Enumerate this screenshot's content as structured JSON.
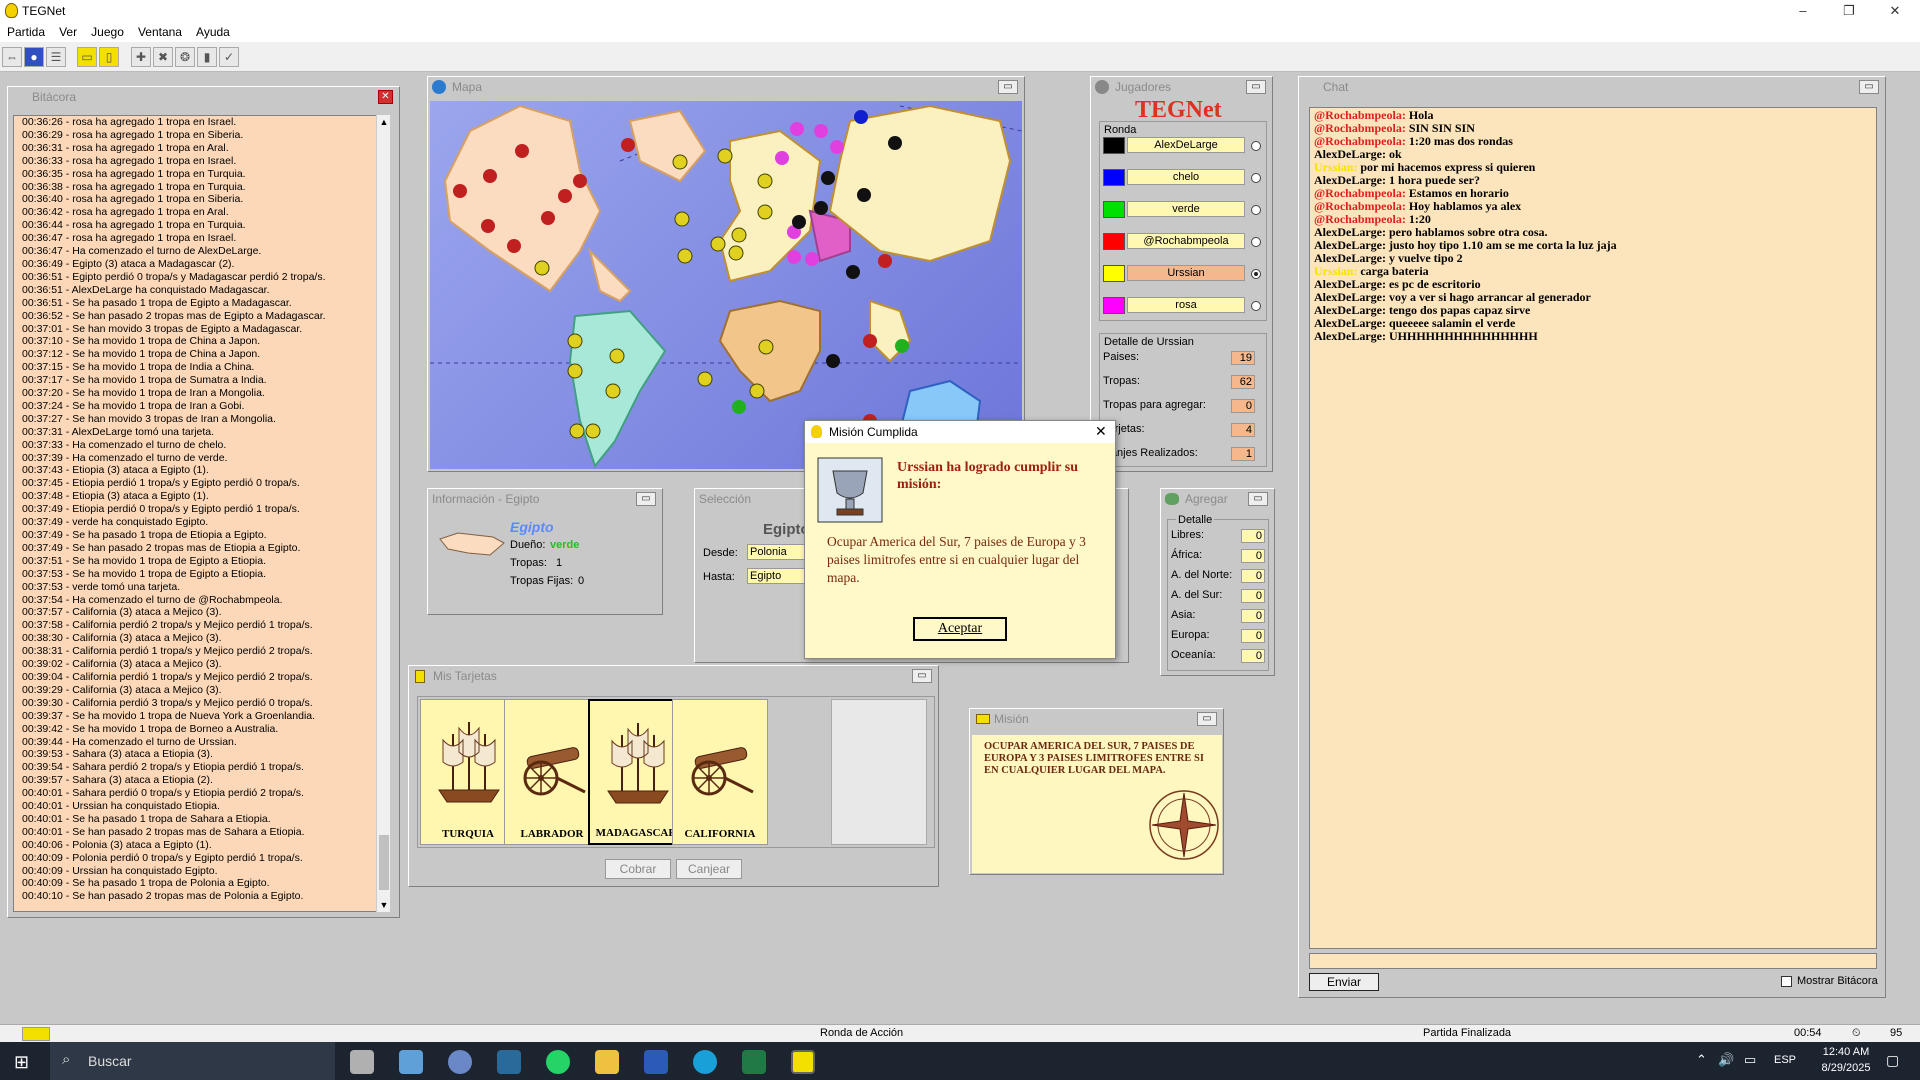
{
  "window": {
    "title": "TEGNet",
    "minimize": "–",
    "restore": "❐",
    "close": "✕"
  },
  "menu": [
    "Partida",
    "Ver",
    "Juego",
    "Ventana",
    "Ayuda"
  ],
  "bitacora": {
    "title": "Bitácora",
    "lines": [
      "00:36:26 - rosa ha agregado 1 tropa en Israel.",
      "00:36:29 - rosa ha agregado 1 tropa en Siberia.",
      "00:36:31 - rosa ha agregado 1 tropa en Aral.",
      "00:36:33 - rosa ha agregado 1 tropa en Israel.",
      "00:36:35 - rosa ha agregado 1 tropa en Turquia.",
      "00:36:38 - rosa ha agregado 1 tropa en Turquia.",
      "00:36:40 - rosa ha agregado 1 tropa en Siberia.",
      "00:36:42 - rosa ha agregado 1 tropa en Aral.",
      "00:36:44 - rosa ha agregado 1 tropa en Turquia.",
      "00:36:47 - rosa ha agregado 1 tropa en Israel.",
      "00:36:47 - Ha comenzado el turno de AlexDeLarge.",
      "00:36:49 - Egipto (3) ataca a Madagascar (2).",
      "00:36:51 - Egipto perdió 0 tropa/s y Madagascar perdió 2 tropa/s.",
      "00:36:51 - AlexDeLarge ha conquistado Madagascar.",
      "00:36:51 - Se ha pasado 1 tropa de Egipto a Madagascar.",
      "00:36:52 - Se han pasado 2 tropas mas de Egipto a Madagascar.",
      "00:37:01 - Se han movido 3 tropas de Egipto a Madagascar.",
      "00:37:10 - Se ha movido 1 tropa de China a Japon.",
      "00:37:12 - Se ha movido 1 tropa de China a Japon.",
      "00:37:15 - Se ha movido 1 tropa de India a China.",
      "00:37:17 - Se ha movido 1 tropa de Sumatra a India.",
      "00:37:20 - Se ha movido 1 tropa de Iran a Mongolia.",
      "00:37:24 - Se ha movido 1 tropa de Iran a Gobi.",
      "00:37:27 - Se han movido 3 tropas de Iran a Mongolia.",
      "00:37:31 - AlexDeLarge tomó una tarjeta.",
      "00:37:33 - Ha comenzado el turno de chelo.",
      "00:37:39 - Ha comenzado el turno de verde.",
      "00:37:43 - Etiopia (3) ataca a Egipto (1).",
      "00:37:45 - Etiopia perdió 1 tropa/s y Egipto perdió 0 tropa/s.",
      "00:37:48 - Etiopia (3) ataca a Egipto (1).",
      "00:37:49 - Etiopia perdió 0 tropa/s y Egipto perdió 1 tropa/s.",
      "00:37:49 - verde ha conquistado Egipto.",
      "00:37:49 - Se ha pasado 1 tropa de Etiopia a Egipto.",
      "00:37:49 - Se han pasado 2 tropas mas de Etiopia a Egipto.",
      "00:37:51 - Se ha movido 1 tropa de Egipto a Etiopia.",
      "00:37:53 - Se ha movido 1 tropa de Egipto a Etiopia.",
      "00:37:53 - verde tomó una tarjeta.",
      "00:37:54 - Ha comenzado el turno de @Rochabmpeola.",
      "00:37:57 - California (3) ataca a Mejico (3).",
      "00:37:58 - California perdió 2 tropa/s y Mejico perdió 1 tropa/s.",
      "00:38:30 - California (3) ataca a Mejico (3).",
      "00:38:31 - California perdió 1 tropa/s y Mejico perdió 2 tropa/s.",
      "00:39:02 - California (3) ataca a Mejico (3).",
      "00:39:04 - California perdió 1 tropa/s y Mejico perdió 2 tropa/s.",
      "00:39:29 - California (3) ataca a Mejico (3).",
      "00:39:30 - California perdió 3 tropa/s y Mejico perdió 0 tropa/s.",
      "00:39:37 - Se ha movido 1 tropa de Nueva York a Groenlandia.",
      "00:39:42 - Se ha movido 1 tropa de Borneo a Australia.",
      "00:39:44 - Ha comenzado el turno de Urssian.",
      "00:39:53 - Sahara (3) ataca a Etiopia (3).",
      "00:39:54 - Sahara perdió 2 tropa/s y Etiopia perdió 1 tropa/s.",
      "00:39:57 - Sahara (3) ataca a Etiopia (2).",
      "00:40:01 - Sahara perdió 0 tropa/s y Etiopia perdió 2 tropa/s.",
      "00:40:01 - Urssian ha conquistado Etiopia.",
      "00:40:01 - Se ha pasado 1 tropa de Sahara a Etiopia.",
      "00:40:01 - Se han pasado 2 tropas mas de Sahara a Etiopia.",
      "00:40:06 - Polonia (3) ataca a Egipto (1).",
      "00:40:09 - Polonia perdió 0 tropa/s y Egipto perdió 1 tropa/s.",
      "00:40:09 - Urssian ha conquistado Egipto.",
      "00:40:09 - Se ha pasado 1 tropa de Polonia a Egipto.",
      "00:40:10 - Se han pasado 2 tropas mas de Polonia a Egipto."
    ]
  },
  "mapa": {
    "title": "Mapa"
  },
  "jugadores": {
    "title": "Jugadores",
    "logo": "TEGNet",
    "ronda_label": "Ronda",
    "players": [
      {
        "name": "AlexDeLarge",
        "color": "#000000",
        "selected": false
      },
      {
        "name": "chelo",
        "color": "#0000ff",
        "selected": false
      },
      {
        "name": "verde",
        "color": "#00e000",
        "selected": false
      },
      {
        "name": "@Rochabmpeola",
        "color": "#ff0000",
        "selected": false
      },
      {
        "name": "Urssian",
        "color": "#ffff00",
        "selected": true
      },
      {
        "name": "rosa",
        "color": "#ff00ff",
        "selected": false
      }
    ],
    "detalle_title": "Detalle de Urssian",
    "stats": [
      {
        "label": "Paises:",
        "value": "19"
      },
      {
        "label": "Tropas:",
        "value": "62"
      },
      {
        "label": "Tropas para agregar:",
        "value": "0"
      },
      {
        "label": "Tarjetas:",
        "value": "4"
      },
      {
        "label": "Canjes Realizados:",
        "value": "1"
      }
    ]
  },
  "chat": {
    "title": "Chat",
    "messages": [
      {
        "user": "@Rochabmpeola:",
        "text": " Hola",
        "cls": "u-r"
      },
      {
        "user": "@Rochabmpeola:",
        "text": " SIN SIN SIN",
        "cls": "u-r"
      },
      {
        "user": "@Rochabmpeola:",
        "text": " 1:20 mas dos rondas",
        "cls": "u-r"
      },
      {
        "user": "AlexDeLarge:",
        "text": " ok",
        "cls": ""
      },
      {
        "user": "Urssian:",
        "text": " por mi hacemos express si quieren",
        "cls": "u-y"
      },
      {
        "user": "AlexDeLarge:",
        "text": " 1 hora puede ser?",
        "cls": ""
      },
      {
        "user": "@Rochabmpeola:",
        "text": " Estamos en horario",
        "cls": "u-r"
      },
      {
        "user": "@Rochabmpeola:",
        "text": " Hoy hablamos ya alex",
        "cls": "u-r"
      },
      {
        "user": "@Rochabmpeola:",
        "text": " 1:20",
        "cls": "u-r"
      },
      {
        "user": "AlexDeLarge:",
        "text": " pero hablamos sobre otra cosa.",
        "cls": ""
      },
      {
        "user": "AlexDeLarge:",
        "text": " justo hoy tipo 1.10 am se me corta la luz jaja",
        "cls": ""
      },
      {
        "user": "AlexDeLarge:",
        "text": " y vuelve tipo 2",
        "cls": ""
      },
      {
        "user": "Urssian:",
        "text": " carga bateria",
        "cls": "u-y"
      },
      {
        "user": "AlexDeLarge:",
        "text": " es pc de escritorio",
        "cls": ""
      },
      {
        "user": "AlexDeLarge:",
        "text": " voy a ver si hago arrancar al generador",
        "cls": ""
      },
      {
        "user": "AlexDeLarge:",
        "text": " tengo dos papas capaz sirve",
        "cls": ""
      },
      {
        "user": "AlexDeLarge:",
        "text": " queeeee salamin el verde",
        "cls": ""
      },
      {
        "user": "AlexDeLarge:",
        "text": " UHHHHHHHHHHHHHHH",
        "cls": ""
      }
    ],
    "send_label": "Enviar",
    "show_bitacora_label": "Mostrar Bitácora"
  },
  "info": {
    "title": "Información - Egipto",
    "country": "Egipto",
    "owner_label": "Dueño:",
    "owner": "verde",
    "troops_label": "Tropas:",
    "troops": "1",
    "fixed_label": "Tropas Fijas:",
    "fixed": "0"
  },
  "seleccion": {
    "title": "Selección",
    "country": "Egipto",
    "desde_label": "Desde:",
    "desde": "Polonia",
    "hasta_label": "Hasta:",
    "hasta": "Egipto"
  },
  "agregar": {
    "title": "Agregar",
    "detalle": "Detalle",
    "rows": [
      {
        "label": "Libres:",
        "value": "0"
      },
      {
        "label": "África:",
        "value": "0"
      },
      {
        "label": "A. del Norte:",
        "value": "0"
      },
      {
        "label": "A. del Sur:",
        "value": "0"
      },
      {
        "label": "Asia:",
        "value": "0"
      },
      {
        "label": "Europa:",
        "value": "0"
      },
      {
        "label": "Oceanía:",
        "value": "0"
      }
    ]
  },
  "tarjetas": {
    "title": "Mis Tarjetas",
    "cards": [
      {
        "name": "TURQUIA",
        "kind": "ship"
      },
      {
        "name": "LABRADOR",
        "kind": "cannon"
      },
      {
        "name": "MADAGASCAR",
        "kind": "ship"
      },
      {
        "name": "CALIFORNIA",
        "kind": "cannon"
      }
    ],
    "cobrar": "Cobrar",
    "canjear": "Canjear"
  },
  "mision": {
    "title": "Misión",
    "text": "OCUPAR AMERICA DEL SUR, 7 PAISES DE EUROPA Y 3 PAISES LIMITROFES ENTRE SI EN CUALQUIER LUGAR DEL MAPA."
  },
  "dialog": {
    "title": "Misión Cumplida",
    "headline": "Urssian ha logrado cumplir su misión:",
    "body": "Ocupar America del Sur, 7 paises de Europa y 3 paises limitrofes entre si en cualquier lugar del mapa.",
    "accept": "Aceptar"
  },
  "status": {
    "phase": "Ronda de Acción",
    "state": "Partida Finalizada",
    "time": "00:54",
    "number": "95"
  },
  "taskbar": {
    "search": "Buscar",
    "lang": "ESP",
    "time": "12:40 AM",
    "date": "8/29/2025"
  }
}
